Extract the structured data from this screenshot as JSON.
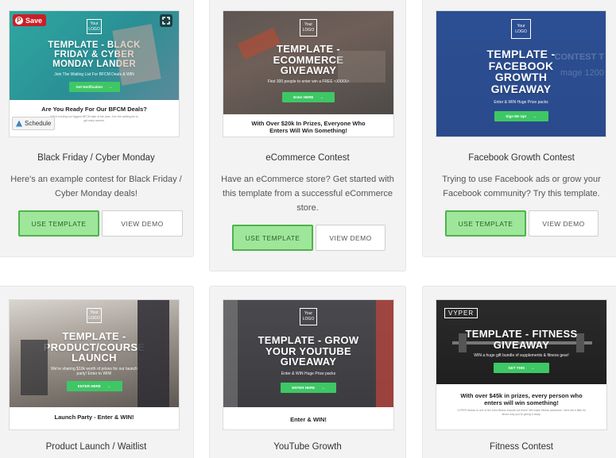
{
  "overlays": {
    "pinterest_save": "Save",
    "schedule": "Schedule",
    "pinterest_color": "#cb1f27"
  },
  "colors": {
    "use_template_bg": "#9ee79a",
    "use_template_border": "#4fb24d",
    "cta_green": "#3ec765"
  },
  "cards": [
    {
      "thumbnail": {
        "logo": "Your LOGO",
        "headline": "TEMPLATE - BLACK FRIDAY & CYBER MONDAY LANDER",
        "subtext": "Join The Waiting List For BFCM Deals & WIN",
        "cta": "Get Notification",
        "below_title": "Are You Ready For Our BFCM Deals?",
        "below_text": "We're hosting our biggest BFCM sale of the year. Join the waiting list to get early access."
      },
      "title": "Black Friday / Cyber Monday",
      "description": "Here's an example contest for Black Friday / Cyber Monday deals!",
      "use_label": "USE TEMPLATE",
      "demo_label": "VIEW DEMO"
    },
    {
      "thumbnail": {
        "logo": "Your LOGO",
        "headline": "TEMPLATE - ECOMMERCE GIVEAWAY",
        "subtext": "First 300 people to enter win a FREE <XXXX>",
        "cta": "Enter HERE",
        "below_title": "With Over $20k In Prizes, Everyone Who Enters Will Win Something!",
        "below_text": ""
      },
      "title": "eCommerce Contest",
      "description": "Have an eCommerce store? Get started with this template from a successful eCommerce store.",
      "use_label": "USE TEMPLATE",
      "demo_label": "VIEW DEMO"
    },
    {
      "thumbnail": {
        "logo": "Your LOGO",
        "headline": "TEMPLATE - FACEBOOK GROWTH GIVEAWAY",
        "ghost_text": "CONTEST T",
        "ghost_text2": "mage 1200",
        "subtext": "Enter & WIN Huge Prize packs",
        "cta": "Sign Me Up!",
        "below_title": "",
        "below_text": ""
      },
      "title": "Facebook Growth Contest",
      "description": "Trying to use Facebook ads or grow your Facebook community? Try this template.",
      "use_label": "USE TEMPLATE",
      "demo_label": "VIEW DEMO"
    },
    {
      "thumbnail": {
        "logo": "Your LOGO",
        "headline": "TEMPLATE - PRODUCT/COURSE LAUNCH",
        "subtext": "We're sharing $10k worth of prizes for our launch party! Enter to WIN!",
        "cta": "ENTER HERE",
        "below_title": "Launch Party - Enter & WIN!",
        "below_text": ""
      },
      "title": "Product Launch / Waitlist"
    },
    {
      "thumbnail": {
        "logo": "Your LOGO",
        "headline": "TEMPLATE - GROW YOUR YOUTUBE GIVEAWAY",
        "subtext": "Enter & WIN Huge Prize packs",
        "cta": "ENTER HERE",
        "below_title": "Enter & WIN!",
        "below_text": ""
      },
      "title": "YouTube Growth"
    },
    {
      "thumbnail": {
        "logo": "VYPER",
        "headline": "TEMPLATE - FITNESS GIVEAWAY",
        "subtext": "WIN a huge gift bundle of supplements & fitness gear!",
        "cta": "GET THIS",
        "below_title": "With over $45k in prizes, every person who enters will win something!",
        "below_text": "VYPER fitness is one of the best fitness brands out there! We make fitness awesome. Here tell a little bit about why you're giving it away."
      },
      "title": "Fitness Contest"
    }
  ]
}
